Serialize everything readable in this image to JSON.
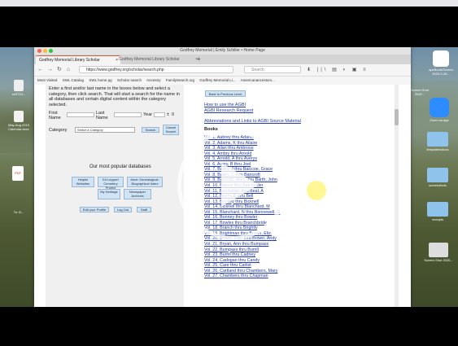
{
  "window": {
    "title": "Godfrey Memorial | Emily Schiller • Home Page",
    "tabs": [
      {
        "label": "Godfrey Memorial Library Scholar"
      },
      {
        "label": "Godfrey Memorial Library Scholar"
      }
    ],
    "url": "https://www.godfrey.org/scholar/search.php",
    "search_placeholder": "Search",
    "bookmarks": [
      "Most Visited",
      "SWL Catalog",
      "SWL home pg",
      "Scholar search",
      "Ancestry",
      "FamilySearch.org",
      "Godfrey Memorial Li...",
      "Americanancestors..."
    ]
  },
  "left": {
    "instructions": "Enter a first and/or last name in the boxes below and select a category, then click search. That will start a search for the name in all databases and certain digital content within the category selected.",
    "first_name_label": "First Name",
    "last_name_label": "Last Name",
    "year_label": "Year",
    "year_pm": "±",
    "year_range": "0",
    "category_label": "Category",
    "category_select": "Select a Category",
    "search_btn": "Search",
    "cancel_btn": "Cancel Search",
    "popular_title": "Our most popular databases",
    "db_buttons": [
      "Helpful Websites",
      "Ed Leppert Cemetery Project",
      "Amer Genealogical-Biographical Index",
      "My Heritage",
      "Newspaper Archives"
    ],
    "bottom_buttons": [
      "Edit your Profile",
      "Log Out",
      "Staff"
    ]
  },
  "right": {
    "back_btn": "Back to Previous Level",
    "link_howto": "How to use the AGBI",
    "link_request": "AGBI Research Request",
    "link_abbrev": "Abbreviations and Links to AGBI Source Material",
    "books_heading": "Books",
    "volumes": [
      "Vol. 1, Aabrey thru Adams",
      "Vol. 2, Adams, K thru Allaire",
      "Vol. 3, Allan thru Ambrose",
      "Vol. 4, Ambry thru Arnold",
      "Vol. 5, Arnold, A thru Averys",
      "Vol. 6, Avery, B thru Joel",
      "Vol. 7, Bailey, J thru Baiccoe, Grace",
      "Vol. 8, Bailey, C thru Bancroft",
      "Vol. 9, Bancroft, Mary thru Barth, John",
      "Vol. 10, Barrett thru Batchelder",
      "Vol. 11, Batchelder thru Beal, A",
      "Vol. 12, Beers, B thru Bell",
      "Vol. 13, Bentley thru Bicknell",
      "Vol. 14, Bicknell thru Blanchard, M",
      "Vol. 15, Blanchard, N thru Bonnewell, G",
      "Vol. 16, Bonney thru Bowler",
      "Vol. 17, Bowles thru Branchbride",
      "Vol. 18, Branch thru Brightly",
      "Vol. 19, Brightman thru Brown, Eliz.",
      "Vol. 20, Brown, Eliz. thru Brown, Andy",
      "Vol. 21, Bryan, Ann thru Bumpass",
      "Vol. 22, Bumpass thru Burrill",
      "Vol. 23, Burrill thru Cadney",
      "Vol. 24, Cadogan thru Candy",
      "Vol. 25, Care thru Carlist",
      "Vol. 26, Cartland thru Chambers, Mary",
      "Vol. 27, Chambers thru Chapman"
    ]
  },
  "desktop": {
    "left_icons": [
      "ce3713...",
      "May-Aug 2019 Calendar.docx",
      "PDF",
      "To: B..."
    ],
    "right_icons": [
      "apeBoothScreen 2020-2-26...",
      "Screen Shot 2020...",
      "zoom",
      "Zoom.us.app",
      "templates/docs",
      "screenshots",
      "receipts",
      "Screen Shot 2020..."
    ]
  },
  "colors": {
    "link": "#2339a8",
    "accent_tab": "#e15c3b",
    "button": "#cfe3f4"
  },
  "overlay": {
    "play_icon": "play-icon"
  }
}
